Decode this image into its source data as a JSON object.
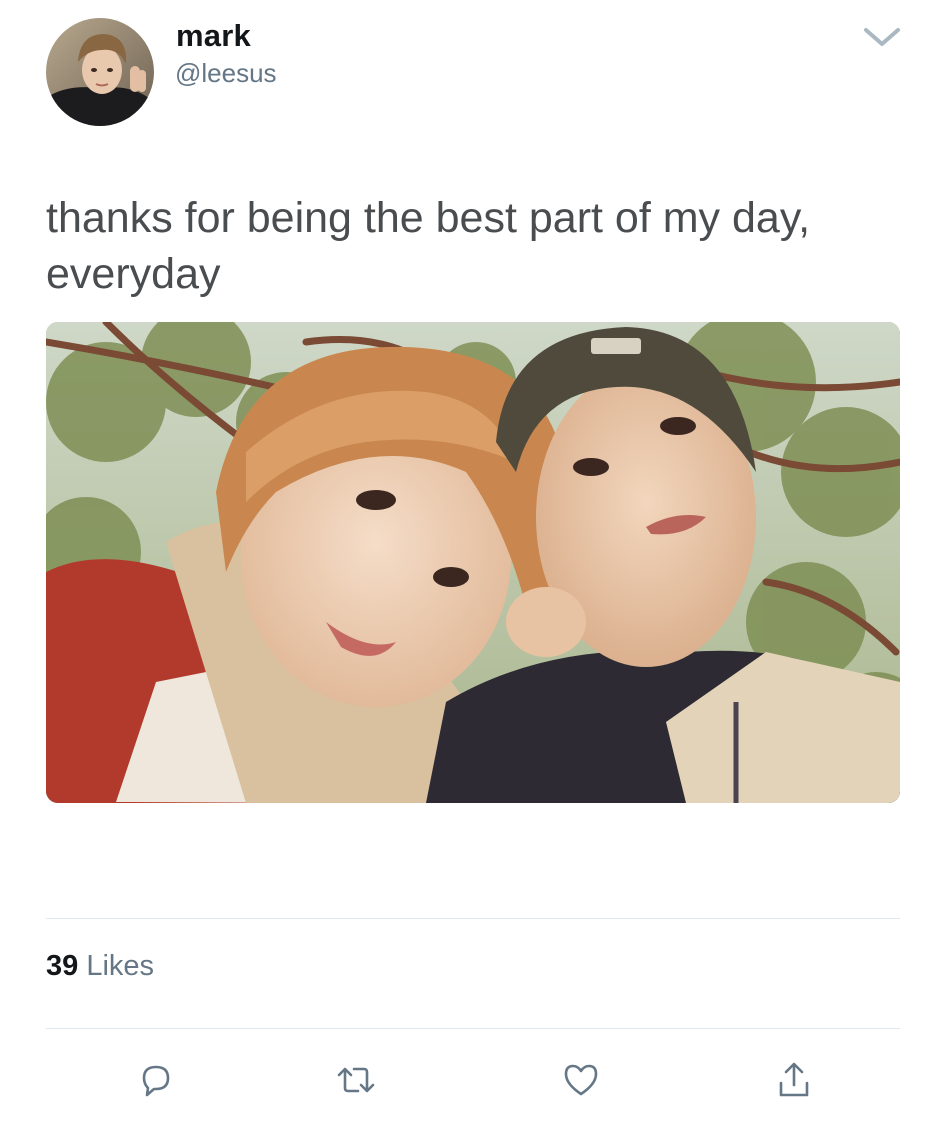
{
  "user": {
    "display_name": "mark",
    "handle": "@leesus",
    "avatar_icon": "profile-photo"
  },
  "tweet": {
    "text": "thanks for being the best part of my day, everyday",
    "media_description_icon": "photo-two-people-under-trees"
  },
  "stats": {
    "likes_count": "39",
    "likes_label": "Likes"
  },
  "actions": [
    {
      "name": "reply",
      "icon": "speech-bubble-icon"
    },
    {
      "name": "retweet",
      "icon": "retweet-arrows-icon"
    },
    {
      "name": "like",
      "icon": "heart-icon"
    },
    {
      "name": "share",
      "icon": "share-arrow-icon"
    }
  ],
  "colors": {
    "text_primary": "#14171a",
    "text_secondary": "#657786",
    "divider": "#e1e8ed",
    "icon": "#657786"
  }
}
